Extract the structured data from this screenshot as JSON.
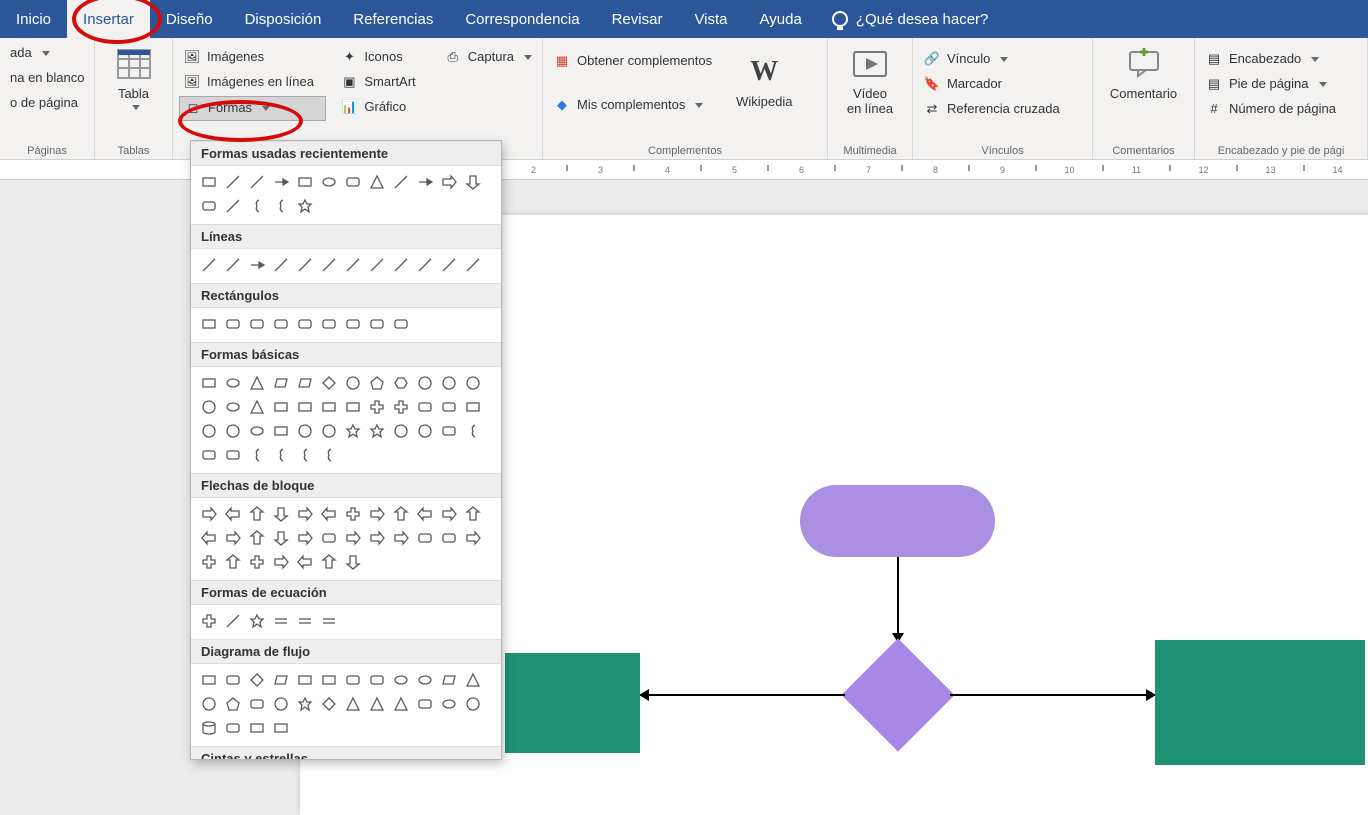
{
  "tabs": {
    "items": [
      "Inicio",
      "Insertar",
      "Diseño",
      "Disposición",
      "Referencias",
      "Correspondencia",
      "Revisar",
      "Vista",
      "Ayuda"
    ],
    "active_index": 1,
    "tellme_placeholder": "¿Qué desea hacer?"
  },
  "ribbon": {
    "pages": {
      "label": "Páginas",
      "btns": [
        "ada",
        "na en blanco",
        "o de página"
      ]
    },
    "tables": {
      "label": "Tablas",
      "btn": "Tabla"
    },
    "illus": {
      "imagenes": "Imágenes",
      "imagenes_linea": "Imágenes en línea",
      "formas": "Formas",
      "iconos": "Iconos",
      "smartart": "SmartArt",
      "grafico": "Gráfico",
      "captura": "Captura"
    },
    "complementos": {
      "label": "Complementos",
      "obtener": "Obtener complementos",
      "mis": "Mis complementos",
      "wikipedia": "Wikipedia"
    },
    "multimedia": {
      "label": "Multimedia",
      "video": "Vídeo\nen línea"
    },
    "vinculos": {
      "label": "Vínculos",
      "vinculo": "Vínculo",
      "marcador": "Marcador",
      "ref": "Referencia cruzada"
    },
    "comentarios": {
      "label": "Comentarios",
      "btn": "Comentario"
    },
    "header": {
      "label": "Encabezado y pie de pági",
      "enc": "Encabezado",
      "pie": "Pie de página",
      "num": "Número de página"
    }
  },
  "gallery": {
    "sections": [
      "Formas usadas recientemente",
      "Líneas",
      "Rectángulos",
      "Formas básicas",
      "Flechas de bloque",
      "Formas de ecuación",
      "Diagrama de flujo",
      "Cintas y estrellas"
    ],
    "counts": [
      17,
      12,
      9,
      42,
      31,
      6,
      28,
      0
    ]
  },
  "ruler": {
    "start": 2,
    "end": 14
  },
  "flowchart": {
    "rounded_color": "#ab8fe2",
    "diamond_color": "#a987e7",
    "rect_color": "#1f9273"
  }
}
